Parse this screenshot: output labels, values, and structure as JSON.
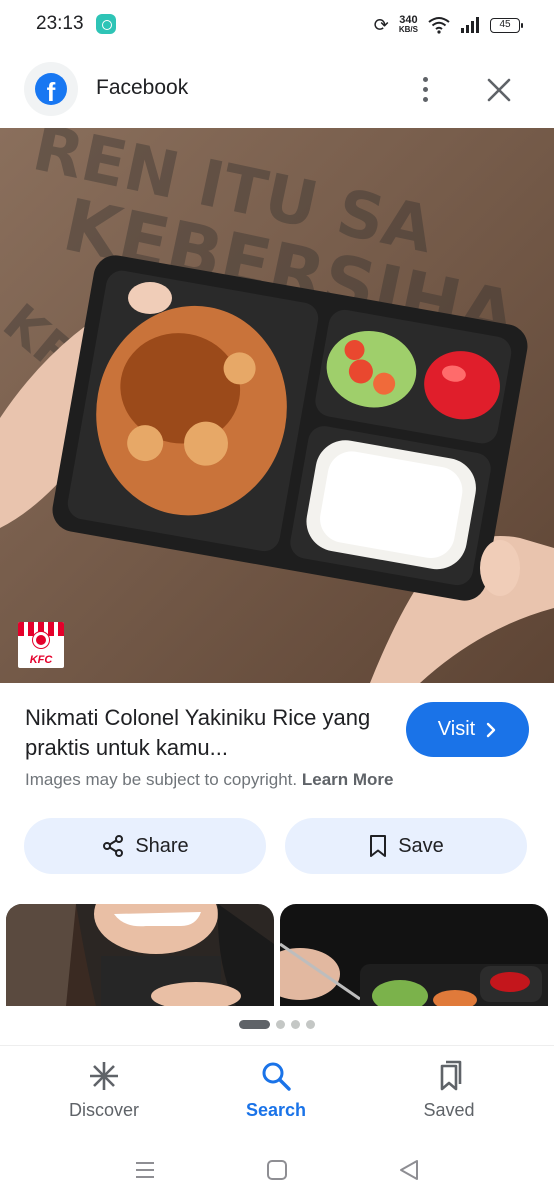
{
  "status_bar": {
    "time": "23:13",
    "speed_value": "340",
    "speed_unit": "KB/S",
    "battery": "45"
  },
  "header": {
    "title": "Facebook",
    "logo_letter": "f"
  },
  "hero": {
    "kfc_logo_text": "KFC"
  },
  "caption": {
    "title": "Nikmati Colonel Yakiniku Rice yang praktis untuk kamu...",
    "visit_label": "Visit",
    "copyright_text": "Images may be subject to copyright.",
    "learn_more_label": "Learn More"
  },
  "actions": {
    "share_label": "Share",
    "save_label": "Save"
  },
  "bottom_nav": {
    "items": [
      {
        "label": "Discover",
        "icon": "asterisk-icon"
      },
      {
        "label": "Search",
        "icon": "search-icon",
        "active": true
      },
      {
        "label": "Saved",
        "icon": "bookmarks-icon"
      }
    ]
  },
  "colors": {
    "accent": "#1a73e8",
    "facebook": "#1877f2",
    "kfc_red": "#e4002b",
    "chip_bg": "#e8f0fe"
  }
}
